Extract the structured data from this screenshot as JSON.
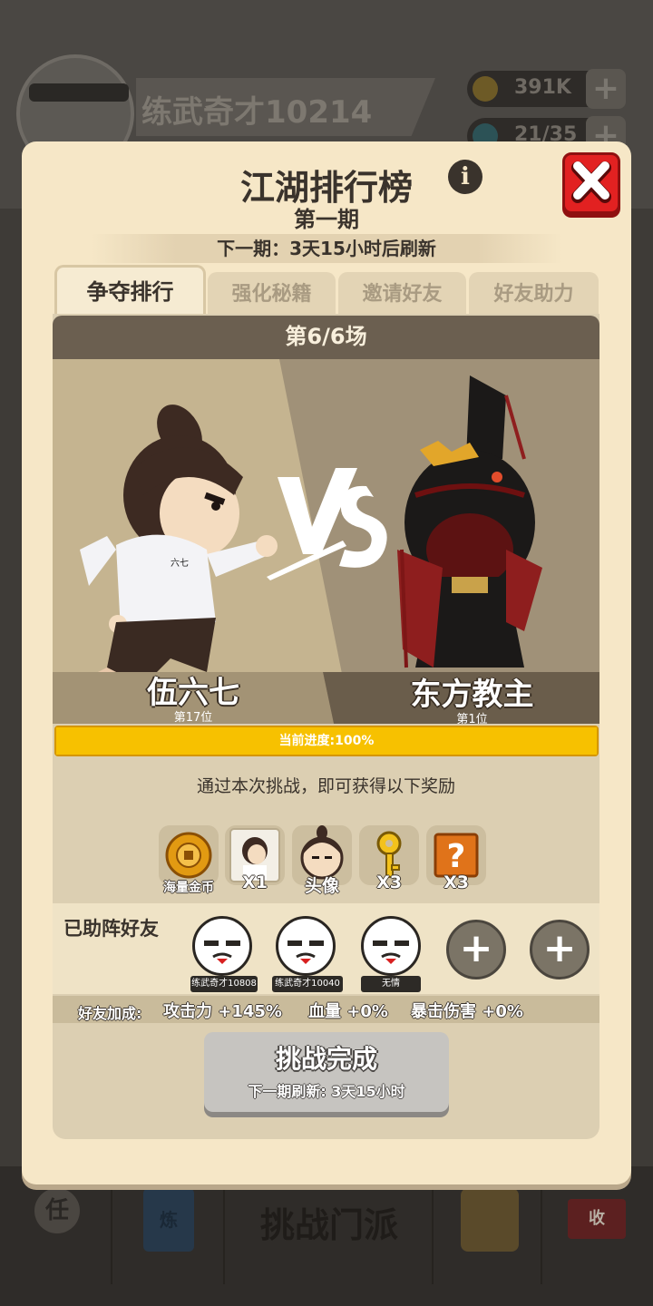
{
  "background": {
    "player_name": "练武奇才10214",
    "coins": "391K",
    "gems": "21/35",
    "nav_center_label": "挑战门派",
    "nav_left_icon_label": "任",
    "nav_second_icon_label": "炼",
    "nav_right_icon_label": "收"
  },
  "modal": {
    "title": "江湖排行榜",
    "subtitle": "第一期",
    "next_refresh": "下一期：3天15小时后刷新",
    "tabs": [
      {
        "label": "争夺排行",
        "active": true
      },
      {
        "label": "强化秘籍",
        "active": false
      },
      {
        "label": "邀请好友",
        "active": false
      },
      {
        "label": "好友助力",
        "active": false
      }
    ],
    "round_label": "第6/6场",
    "player": {
      "name": "伍六七",
      "rank": "第17位",
      "shirt_text": "六七"
    },
    "opponent": {
      "name": "东方教主",
      "rank": "第1位"
    },
    "progress": {
      "label": "当前进度:100%",
      "value": 1.0
    },
    "reward_hint": "通过本次挑战，即可获得以下奖励",
    "rewards": [
      {
        "icon": "gold-coin-icon",
        "label": "海量金币"
      },
      {
        "icon": "character-card-icon",
        "label": "X1"
      },
      {
        "icon": "avatar-portrait-icon",
        "label": "头像"
      },
      {
        "icon": "key-icon",
        "label": "X3"
      },
      {
        "icon": "mystery-box-icon",
        "label": "X3"
      }
    ],
    "friends": {
      "label": "已助阵好友",
      "list": [
        {
          "name": "练武奇才10808"
        },
        {
          "name": "练武奇才10040"
        },
        {
          "name": "无情"
        }
      ],
      "empty_slots": 2
    },
    "bonus": {
      "label": "好友加成:",
      "attack": "攻击力 +145%",
      "hp": "血量 +0%",
      "crit": "暴击伤害 +0%"
    },
    "action": {
      "title": "挑战完成",
      "subtitle": "下一期刷新: 3天15小时"
    },
    "colors": {
      "accent": "#f7c100",
      "panel": "#f6e7c7",
      "close": "#e22121"
    }
  }
}
